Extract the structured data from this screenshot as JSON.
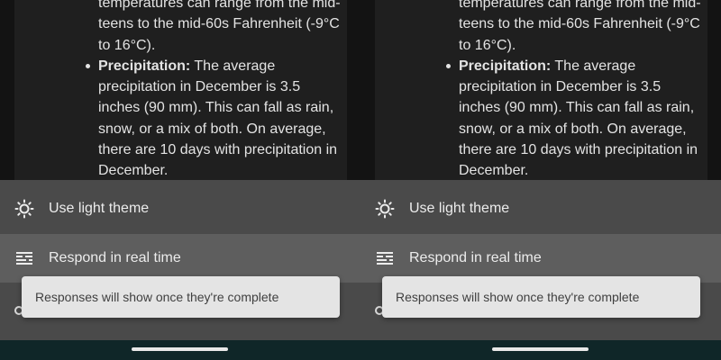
{
  "chat": {
    "line_temps": "temperatures can range from the mid-teens to the mid-60s Fahrenheit (-9°C to 16°C).",
    "precip_label": "Precipitation:",
    "precip_text": " The average precipitation in December is 3.5 inches (90 mm). This can fall as rain, snow, or a mix of both. On average, there are 10 days with precipitation in December."
  },
  "menu": {
    "light_theme": {
      "label": "Use light theme",
      "icon": "sun-icon"
    },
    "realtime": {
      "label": "Respond in real time",
      "icon": "realtime-lines-icon"
    }
  },
  "toast": {
    "text": "Responses will show once they're complete"
  },
  "colors": {
    "sheet": "#4a4a4a",
    "highlight": "#5e5e5e",
    "toast_bg": "#e4e4e4",
    "navbar": "#0f2628"
  }
}
